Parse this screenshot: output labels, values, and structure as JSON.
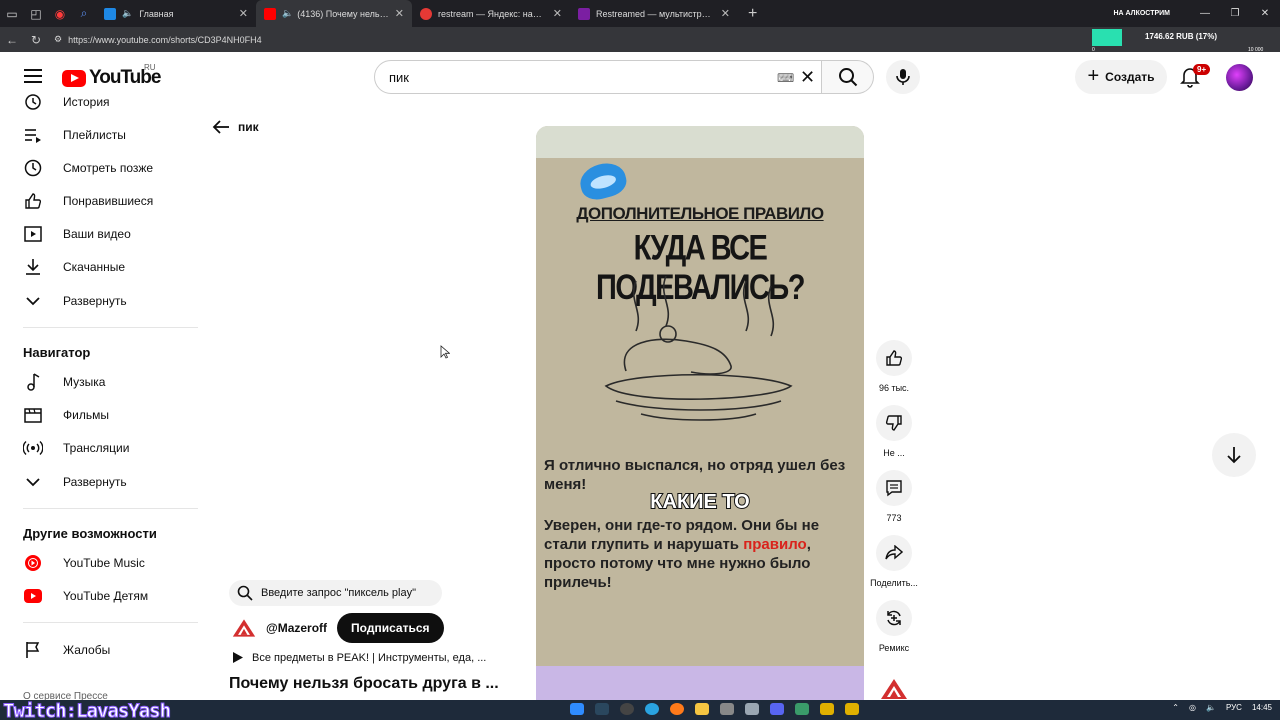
{
  "browser": {
    "tabs": [
      {
        "title": "Главная",
        "favicon_color": "#1e88e5"
      },
      {
        "title": "(4136) Почему нельзя бросать",
        "favicon_color": "#ff0000",
        "active": true
      },
      {
        "title": "restream — Яндекс: нашлось 6 тыс.",
        "favicon_color": "#e53935"
      },
      {
        "title": "Restreamed — мультистриминг: с",
        "favicon_color": "#7b1fa2"
      }
    ],
    "url": "https://www.youtube.com/shorts/CD3P4NH0FH4",
    "overlay": {
      "label": "НА АЛКОСТРИМ",
      "amount": "1746.62 RUB (17%)",
      "min": "0",
      "max": "10 000"
    }
  },
  "header": {
    "logo_text": "YouTube",
    "country": "RU",
    "search_value": "пик",
    "create_label": "Создать",
    "notification_badge": "9+"
  },
  "sidebar": {
    "items_top": [
      {
        "label": "История",
        "icon": "history-icon"
      },
      {
        "label": "Плейлисты",
        "icon": "playlists-icon"
      },
      {
        "label": "Смотреть позже",
        "icon": "clock-icon"
      },
      {
        "label": "Понравившиеся",
        "icon": "thumbs-up-icon"
      },
      {
        "label": "Ваши видео",
        "icon": "your-videos-icon"
      },
      {
        "label": "Скачанные",
        "icon": "download-icon"
      },
      {
        "label": "Развернуть",
        "icon": "chevron-down-icon"
      }
    ],
    "nav_heading": "Навигатор",
    "nav_items": [
      {
        "label": "Музыка",
        "icon": "music-icon"
      },
      {
        "label": "Фильмы",
        "icon": "film-icon"
      },
      {
        "label": "Трансляции",
        "icon": "live-icon"
      },
      {
        "label": "Развернуть",
        "icon": "chevron-down-icon"
      }
    ],
    "more_heading": "Другие возможности",
    "more_items": [
      {
        "label": "YouTube Music",
        "icon": "youtube-music-icon"
      },
      {
        "label": "YouTube Детям",
        "icon": "youtube-kids-icon"
      }
    ],
    "report_label": "Жалобы",
    "footer": "О сервисе   Прессе"
  },
  "main": {
    "back_label": "пик",
    "suggestion": "Введите запрос \"пиксель play\"",
    "channel_name": "@Mazeroff",
    "subscribe_label": "Подписаться",
    "playlist_label": "Все предметы в PEAK! | Инструменты, еда, ...",
    "video_title": "Почему нельзя бросать друга в ..."
  },
  "video_frame": {
    "line1": "ДОПОЛНИТЕЛЬНОЕ ПРАВИЛО",
    "line2": "КУДА ВСЕ ПОДЕВАЛИСЬ?",
    "para1": "Я отлично выспался, но отряд ушел без меня!",
    "caption": "КАКИЕ ТО",
    "para2_a": "Уверен, они где-то рядом. Они бы не стали глупить и нарушать ",
    "para2_red": "правило",
    "para2_b": ", просто потому что мне нужно было прилечь!"
  },
  "actions": {
    "like_count": "96 тыс.",
    "dislike_label": "Не ...",
    "comments_count": "773",
    "share_label": "Поделить...",
    "remix_label": "Ремикс"
  },
  "taskbar": {
    "stream_tag": "Twitch:LavasYash",
    "lang": "РУС",
    "time": "14:45"
  }
}
